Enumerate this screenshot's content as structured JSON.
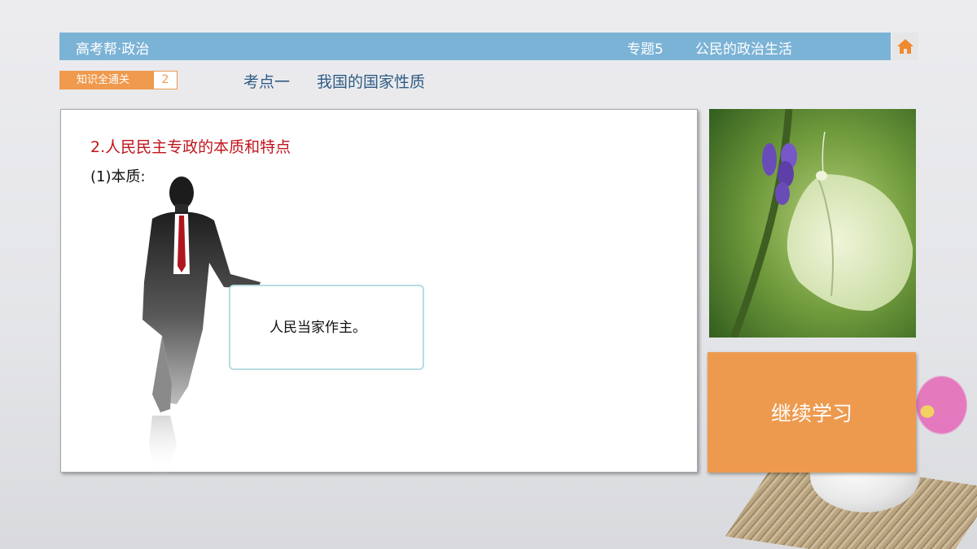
{
  "header": {
    "brand": "高考帮·政治",
    "topic_number": "专题5",
    "topic_name": "公民的政治生活",
    "home_icon": "home-icon"
  },
  "subheader": {
    "section_label": "知识全通关",
    "section_number": "2",
    "point_label": "考点一",
    "point_title": "我国的国家性质"
  },
  "content": {
    "heading": "2.人民民主专政的本质和特点",
    "subheading": "(1)本质:",
    "answer": "人民当家作主。"
  },
  "sidebar": {
    "continue_label": "继续学习"
  },
  "colors": {
    "header_blue": "#7bb3d6",
    "accent_orange": "#ee9a4e",
    "heading_red": "#c0161d",
    "title_blue": "#2f5b85"
  }
}
